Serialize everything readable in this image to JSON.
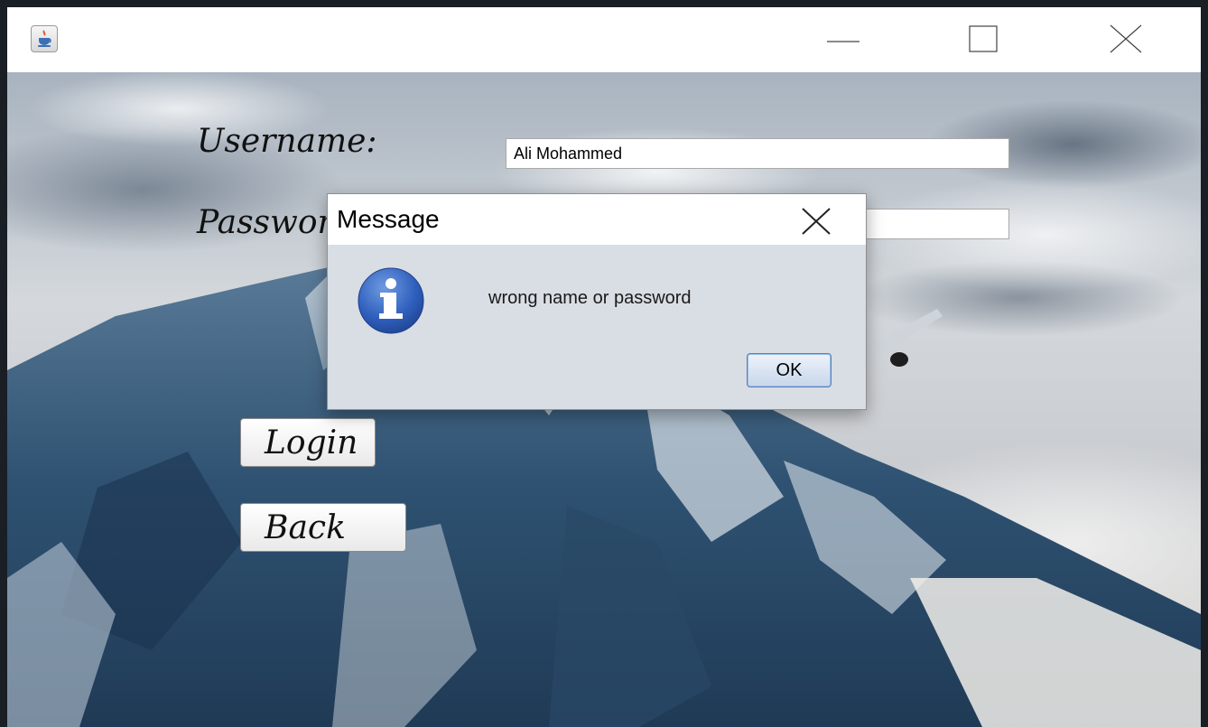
{
  "window": {
    "icon": "java-coffee-icon",
    "controls": {
      "minimize_icon": "minimize-icon",
      "maximize_icon": "maximize-icon",
      "close_icon": "close-icon"
    }
  },
  "login_form": {
    "username_label": "Username:",
    "username_value": "Ali Mohammed",
    "password_label": "Password:",
    "password_value": "****",
    "login_button_label": "Login",
    "back_button_label": "Back"
  },
  "dialog": {
    "title": "Message",
    "icon": "info-icon",
    "message": "wrong name or password",
    "ok_button_label": "OK",
    "close_icon": "close-icon"
  },
  "colors": {
    "info_icon_blue": "#2f5fbd",
    "ok_button_border": "#5b7fb0",
    "dialog_background": "#d9dde4"
  }
}
